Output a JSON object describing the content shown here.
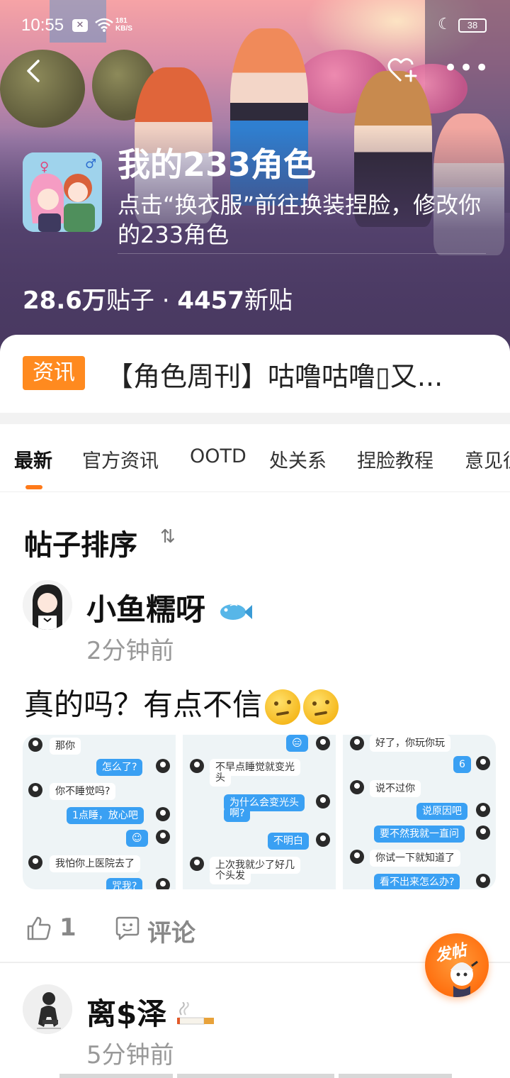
{
  "status_bar": {
    "time": "10:55",
    "net_speed_value": "181",
    "net_speed_unit": "KB/S",
    "battery": "38"
  },
  "header": {
    "title": "我的233角色",
    "description": "点击“换衣服”前往换装捏脸，修改你的233角色",
    "posts_count": "28.6万",
    "posts_label": "贴子",
    "dot": "·",
    "new_count": "4457",
    "new_label": "新贴"
  },
  "news": {
    "tag": "资讯",
    "title": "【角色周刊】咕噜咕噜▯又..."
  },
  "tabs": [
    {
      "label": "最新",
      "active": true
    },
    {
      "label": "官方资讯",
      "active": false
    },
    {
      "label": "OOTD",
      "active": false
    },
    {
      "label": "处关系",
      "active": false
    },
    {
      "label": "捏脸教程",
      "active": false
    },
    {
      "label": "意见征",
      "active": false
    }
  ],
  "sort": {
    "label": "帖子排序",
    "icon": "sort-arrows-icon"
  },
  "posts": [
    {
      "author": "小鱼糯呀",
      "time": "2分钟前",
      "text": "真的吗？有点不信",
      "emoji": "thinking-face-icon",
      "images": [
        {
          "messages": [
            {
              "side": "l",
              "text": "那你"
            },
            {
              "side": "r",
              "text": "怎么了?"
            },
            {
              "side": "l",
              "text": "你不睡觉吗?"
            },
            {
              "side": "r",
              "text": "1点睡，放心吧"
            },
            {
              "side": "r",
              "text": "☺"
            },
            {
              "side": "l",
              "text": "我怕你上医院去了"
            },
            {
              "side": "r",
              "text": "咒我?"
            }
          ]
        },
        {
          "messages": [
            {
              "side": "r",
              "text": "😑"
            },
            {
              "side": "l",
              "text": "不早点睡觉就变光"
            },
            {
              "side": "l",
              "text": "头"
            },
            {
              "side": "r",
              "text": "为什么会变光头"
            },
            {
              "side": "r",
              "text": "啊?"
            },
            {
              "side": "r",
              "text": "不明白"
            },
            {
              "side": "l",
              "text": "上次我就少了好几"
            },
            {
              "side": "l",
              "text": "个头发"
            }
          ]
        },
        {
          "messages": [
            {
              "side": "l",
              "text": "好了，你玩你玩"
            },
            {
              "side": "r",
              "text": "6"
            },
            {
              "side": "l",
              "text": "说不过你"
            },
            {
              "side": "r",
              "text": "说原因吧"
            },
            {
              "side": "r",
              "text": "要不然我就一直问"
            },
            {
              "side": "l",
              "text": "你试一下就知道了"
            },
            {
              "side": "r",
              "text": "看不出来怎么办?"
            }
          ]
        }
      ],
      "likes": "1",
      "comment_label": "评论"
    },
    {
      "author": "离$泽",
      "time": "5分钟前",
      "emoji": "cigarette-icon"
    }
  ],
  "fab": {
    "label": "发帖"
  },
  "colors": {
    "accent": "#ff8a1f",
    "tab_indicator": "#ff7a1a",
    "chat_blue": "#3aa0f3"
  }
}
